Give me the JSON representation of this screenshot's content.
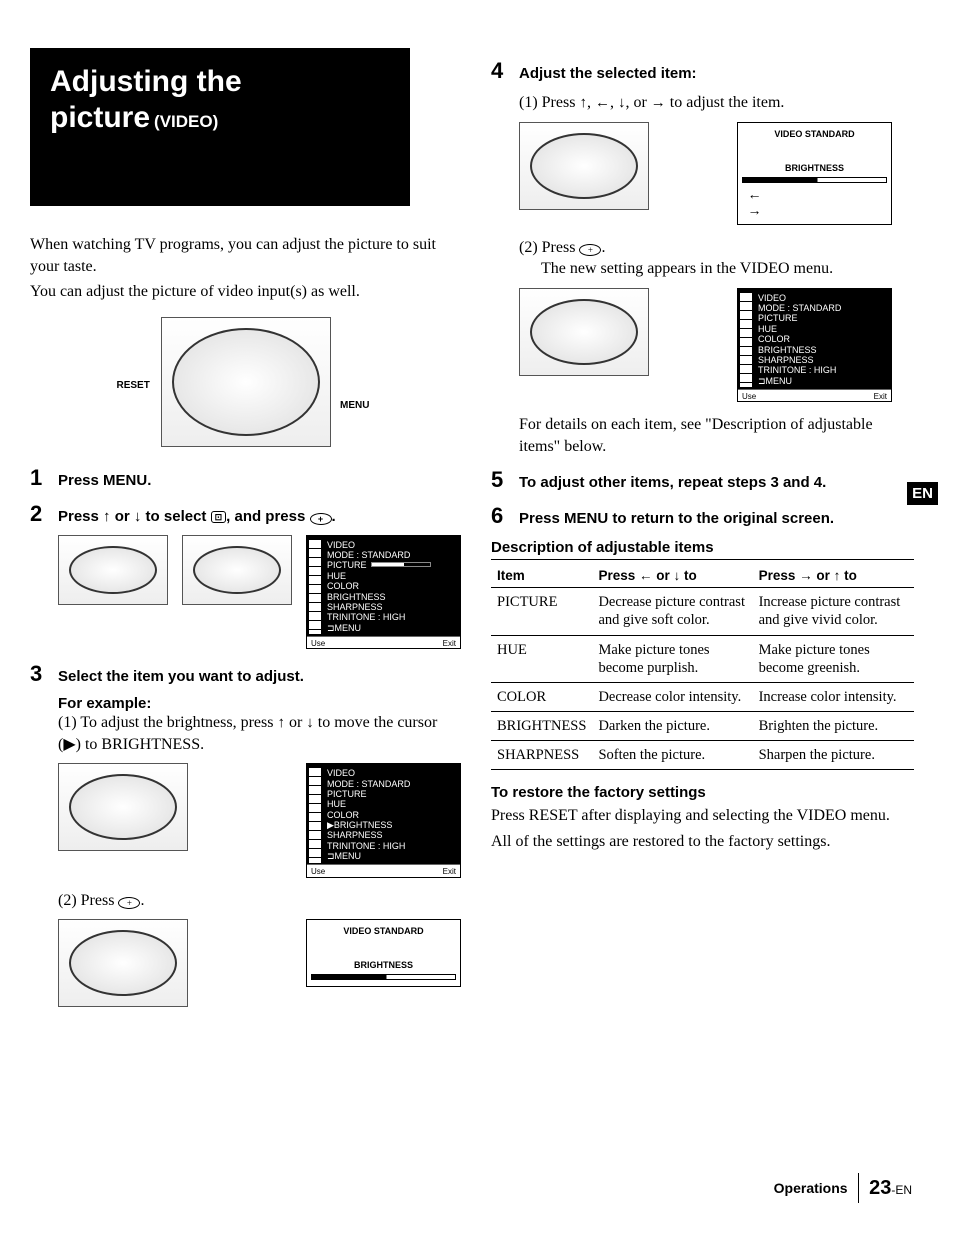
{
  "title": {
    "line1": "Adjusting the",
    "line2": "picture",
    "sub": "(VIDEO)"
  },
  "intro": {
    "p1": "When watching TV programs, you can adjust the picture to suit your taste.",
    "p2": "You can adjust the picture of video input(s) as well."
  },
  "remote_labels": {
    "reset": "RESET",
    "menu": "MENU"
  },
  "steps": {
    "s1": "Press MENU.",
    "s2_a": "Press ",
    "s2_b": " or ",
    "s2_c": " to select ",
    "s2_d": ", and press ",
    "s2_e": ".",
    "s3": "Select the item you want to adjust.",
    "example": "For example:",
    "s3_1a": "(1) To adjust the brightness, press ",
    "s3_1b": " or ",
    "s3_1c": " to move the cursor (▶) to BRIGHTNESS.",
    "s3_2a": "(2) Press ",
    "s3_2b": ".",
    "s4": "Adjust the selected item:",
    "s4_1a": "(1) Press ",
    "s4_1b": ", ",
    "s4_1c": ", ",
    "s4_1d": ", or ",
    "s4_1e": " to adjust the item.",
    "s4_2a": "(2) Press ",
    "s4_2b": ".",
    "s4_2c": "The new setting appears in the VIDEO menu.",
    "s4_detail": "For details on each item, see \"Description of adjustable items\" below.",
    "s5": "To adjust other items, repeat steps 3 and 4.",
    "s6": "Press MENU to return to the original screen."
  },
  "osd": {
    "video": "VIDEO",
    "mode": "MODE : STANDARD",
    "picture": "PICTURE",
    "hue": "HUE",
    "color": "COLOR",
    "brightness": "BRIGHTNESS",
    "sharpness": "SHARPNESS",
    "trinitone": "TRINITONE : HIGH",
    "menu": "⊐MENU",
    "use": "Use",
    "exit": "Exit",
    "video_std": "VIDEO STANDARD",
    "bright_lbl": "BRIGHTNESS"
  },
  "desc_head": "Description of adjustable items",
  "table": {
    "h1": "Item",
    "h2": "Press ← or ↓ to",
    "h3": "Press → or ↑ to",
    "rows": [
      {
        "item": "PICTURE",
        "left": "Decrease picture contrast and give soft color.",
        "right": "Increase picture contrast and give vivid color."
      },
      {
        "item": "HUE",
        "left": "Make picture tones become purplish.",
        "right": "Make picture tones become greenish."
      },
      {
        "item": "COLOR",
        "left": "Decrease color intensity.",
        "right": "Increase color intensity."
      },
      {
        "item": "BRIGHTNESS",
        "left": "Darken the picture.",
        "right": "Brighten the picture."
      },
      {
        "item": "SHARPNESS",
        "left": "Soften the picture.",
        "right": "Sharpen the picture."
      }
    ]
  },
  "restore": {
    "head": "To restore the factory settings",
    "p1": "Press RESET after displaying and selecting the VIDEO menu.",
    "p2": "All of the settings are restored to the factory settings."
  },
  "badge": "EN",
  "footer": {
    "section": "Operations",
    "page": "23",
    "suffix": "-EN"
  }
}
